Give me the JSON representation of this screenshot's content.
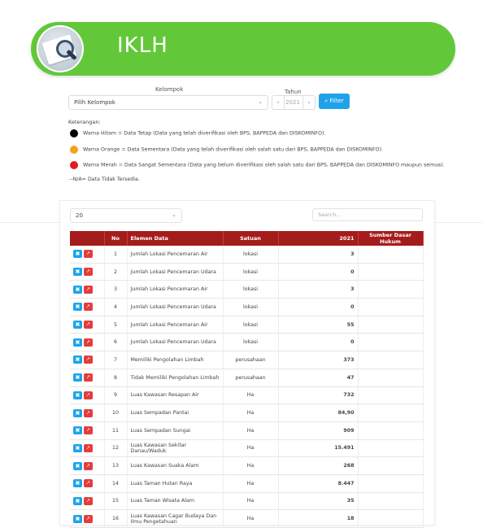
{
  "header": {
    "title": "IKLH"
  },
  "filter": {
    "kelompok_label": "Kelompok",
    "kelompok_value": "Pilih Kelompok",
    "tahun_label": "Tahun",
    "tahun_value": "2021",
    "prev": "‹",
    "next": "›",
    "filter_button": "Filter"
  },
  "legend": {
    "title": "Keterangan:",
    "items": [
      {
        "color": "#000000",
        "text": "Warna Hitam = Data Tetap (Data yang telah diverifikasi oleh BPS, BAPPEDA dan DISKOMINFO)."
      },
      {
        "color": "#f5a21b",
        "text": "Warna Orange = Data Sementara (Data yang telah diverifikasi oleh salah satu dari BPS, BAPPEDA dan DISKOMINFO)."
      },
      {
        "color": "#e51b1b",
        "text": "Warna Merah = Data Sangat Sementara (Data yang belum diverifikasi oleh salah satu dari BPS, BAPPEDA dan DISKOMINFO maupun semua)."
      }
    ],
    "na_note": "--N/A= Data Tidak Tersedia."
  },
  "table_controls": {
    "page_size": "20",
    "search_placeholder": "Search..."
  },
  "table": {
    "columns": [
      "",
      "No",
      "Elemen Data",
      "Satuan",
      "2021",
      "Sumber Dasar Hukum"
    ],
    "rows": [
      {
        "no": "1",
        "elemen": "Jumlah Lokasi Pencemaran Air",
        "satuan": "lokasi",
        "value": "3",
        "sumber": ""
      },
      {
        "no": "2",
        "elemen": "Jumlah Lokasi Pencemaran Udara",
        "satuan": "lokasi",
        "value": "0",
        "sumber": ""
      },
      {
        "no": "3",
        "elemen": "Jumlah Lokasi Pencemaran Air",
        "satuan": "lokasi",
        "value": "3",
        "sumber": ""
      },
      {
        "no": "4",
        "elemen": "Jumlah Lokasi Pencemaran Udara",
        "satuan": "lokasi",
        "value": "0",
        "sumber": ""
      },
      {
        "no": "5",
        "elemen": "Jumlah Lokasi Pencemaran Air",
        "satuan": "lokasi",
        "value": "55",
        "sumber": ""
      },
      {
        "no": "6",
        "elemen": "Jumlah Lokasi Pencemaran Udara",
        "satuan": "lokasi",
        "value": "0",
        "sumber": ""
      },
      {
        "no": "7",
        "elemen": "Memiliki Pengolahan Limbah",
        "satuan": "perusahaan",
        "value": "373",
        "sumber": ""
      },
      {
        "no": "8",
        "elemen": "Tidak Memiliki Pengolahan Limbah",
        "satuan": "perusahaan",
        "value": "47",
        "sumber": ""
      },
      {
        "no": "9",
        "elemen": "Luas Kawasan Resapan Air",
        "satuan": "Ha",
        "value": "732",
        "sumber": ""
      },
      {
        "no": "10",
        "elemen": "Luas Sempadan Pantai",
        "satuan": "Ha",
        "value": "84,90",
        "sumber": ""
      },
      {
        "no": "11",
        "elemen": "Luas Sempadan Sungai",
        "satuan": "Ha",
        "value": "909",
        "sumber": ""
      },
      {
        "no": "12",
        "elemen": "Luas Kawasan Sekitar Danau/Waduk",
        "satuan": "Ha",
        "value": "15.491",
        "sumber": ""
      },
      {
        "no": "13",
        "elemen": "Luas Kawasan Suaka Alam",
        "satuan": "Ha",
        "value": "268",
        "sumber": ""
      },
      {
        "no": "14",
        "elemen": "Luas Taman Hutan Raya",
        "satuan": "Ha",
        "value": "8.447",
        "sumber": ""
      },
      {
        "no": "15",
        "elemen": "Luas Taman Wisata Alam",
        "satuan": "Ha",
        "value": "35",
        "sumber": ""
      },
      {
        "no": "16",
        "elemen": "Luas Kawasan Cagar Budaya Dan Ilmu Pengetahuan",
        "satuan": "Ha",
        "value": "18",
        "sumber": ""
      }
    ]
  },
  "icons": {
    "map": "map-icon",
    "chart": "chart-icon"
  },
  "colors": {
    "banner": "#62c83a",
    "table_header": "#a51c1c",
    "value": "#c31b1b",
    "filter_button": "#1ea3ea"
  }
}
